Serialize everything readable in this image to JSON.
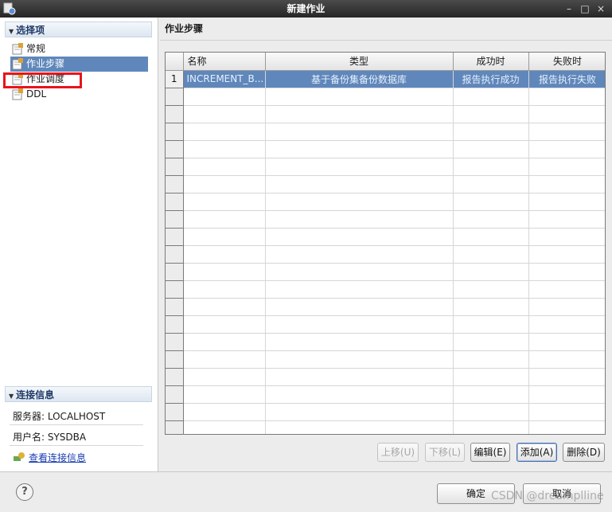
{
  "window": {
    "title": "新建作业",
    "minimize": "–",
    "maximize": "□",
    "close": "×"
  },
  "sidebar": {
    "select_header": "选择项",
    "items": [
      {
        "label": "常规",
        "icon": "settings-page-icon"
      },
      {
        "label": "作业步骤",
        "icon": "settings-page-icon"
      },
      {
        "label": "作业调度",
        "icon": "settings-page-icon"
      },
      {
        "label": "DDL",
        "icon": "settings-page-icon"
      }
    ],
    "connection_header": "连接信息",
    "server": "服务器: LOCALHOST",
    "user": "用户名: SYSDBA",
    "view_link": "查看连接信息"
  },
  "panel": {
    "title": "作业步骤"
  },
  "table": {
    "columns": [
      "名称",
      "类型",
      "成功时",
      "失败时"
    ],
    "rows": [
      {
        "index": "1",
        "name": "INCREMENT_B...",
        "type": "基于备份集备份数据库",
        "on_success": "报告执行成功",
        "on_failure": "报告执行失败"
      }
    ]
  },
  "buttons": {
    "move_up": "上移(U)",
    "move_down": "下移(L)",
    "edit": "编辑(E)",
    "add": "添加(A)",
    "delete": "删除(D)",
    "ok": "确定",
    "cancel": "取消"
  },
  "help": "?",
  "watermark": "CSDN @dreamplline",
  "colors": {
    "selection": "#5f87bb",
    "highlight_box": "#e8141c",
    "link": "#1a3db0"
  }
}
